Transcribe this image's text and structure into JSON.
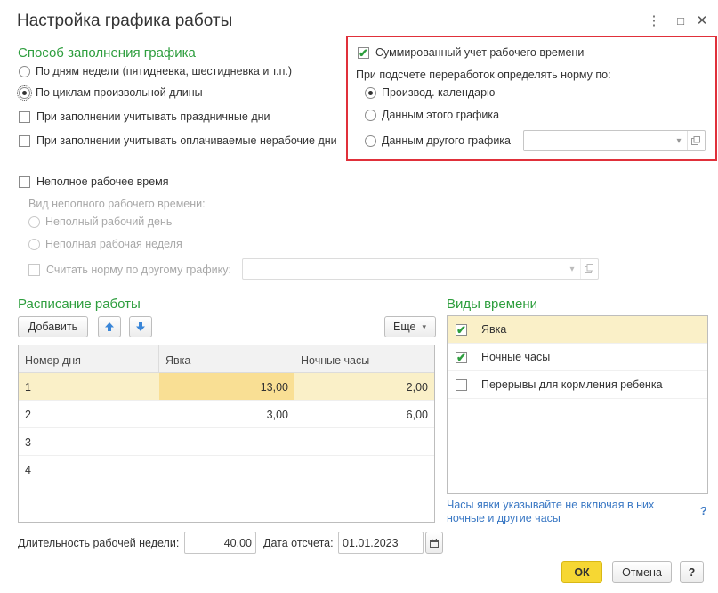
{
  "window": {
    "title": "Настройка графика работы",
    "more_icon": "⋮",
    "maximize_icon": "□",
    "close_icon": "✕"
  },
  "fill_method": {
    "title": "Способ заполнения графика",
    "options": [
      {
        "label": "По дням недели (пятидневка, шестидневка и т.п.)",
        "selected": false
      },
      {
        "label": "По циклам произвольной длины",
        "selected": true
      }
    ],
    "consider_holidays": {
      "label": "При заполнении учитывать праздничные дни",
      "checked": false
    },
    "consider_paid_nonworking": {
      "label": "При заполнении учитывать оплачиваемые нерабочие дни",
      "checked": false
    }
  },
  "summarized": {
    "checkbox_label": "Суммированный учет рабочего времени",
    "checked": true,
    "norm_caption": "При подсчете переработок определять норму по:",
    "options": [
      {
        "label": "Производ. календарю",
        "selected": true
      },
      {
        "label": "Данным этого графика",
        "selected": false
      },
      {
        "label": "Данным другого графика",
        "selected": false
      }
    ],
    "other_schedule_value": ""
  },
  "part_time": {
    "checkbox_label": "Неполное рабочее время",
    "checked": false,
    "kind_caption": "Вид неполного рабочего времени:",
    "options": [
      {
        "label": "Неполный рабочий день"
      },
      {
        "label": "Неполная рабочая неделя"
      }
    ],
    "norm_other_label": "Считать норму по другому графику:",
    "norm_other_value": ""
  },
  "schedule": {
    "title": "Расписание работы",
    "add_label": "Добавить",
    "more_label": "Еще",
    "columns": [
      "Номер дня",
      "Явка",
      "Ночные часы"
    ],
    "rows": [
      {
        "day": "1",
        "attendance": "13,00",
        "night": "2,00"
      },
      {
        "day": "2",
        "attendance": "3,00",
        "night": "6,00"
      },
      {
        "day": "3",
        "attendance": "",
        "night": ""
      },
      {
        "day": "4",
        "attendance": "",
        "night": ""
      }
    ],
    "week_length_label": "Длительность рабочей недели:",
    "week_length_value": "40,00",
    "ref_date_label": "Дата отсчета:",
    "ref_date_value": "01.01.2023"
  },
  "time_types": {
    "title": "Виды времени",
    "items": [
      {
        "label": "Явка",
        "checked": true
      },
      {
        "label": "Ночные часы",
        "checked": true
      },
      {
        "label": "Перерывы для кормления ребенка",
        "checked": false
      }
    ],
    "hint": "Часы явки указывайте не включая в них ночные и другие часы",
    "help": "?"
  },
  "footer": {
    "ok_label": "ОК",
    "cancel_label": "Отмена",
    "help_label": "?"
  },
  "colors": {
    "accent_green": "#2e9e3e",
    "highlight_border": "#e0303a",
    "selection_row": "#faf0c8",
    "ok_button": "#f6d733",
    "link_blue": "#3a78c4"
  }
}
